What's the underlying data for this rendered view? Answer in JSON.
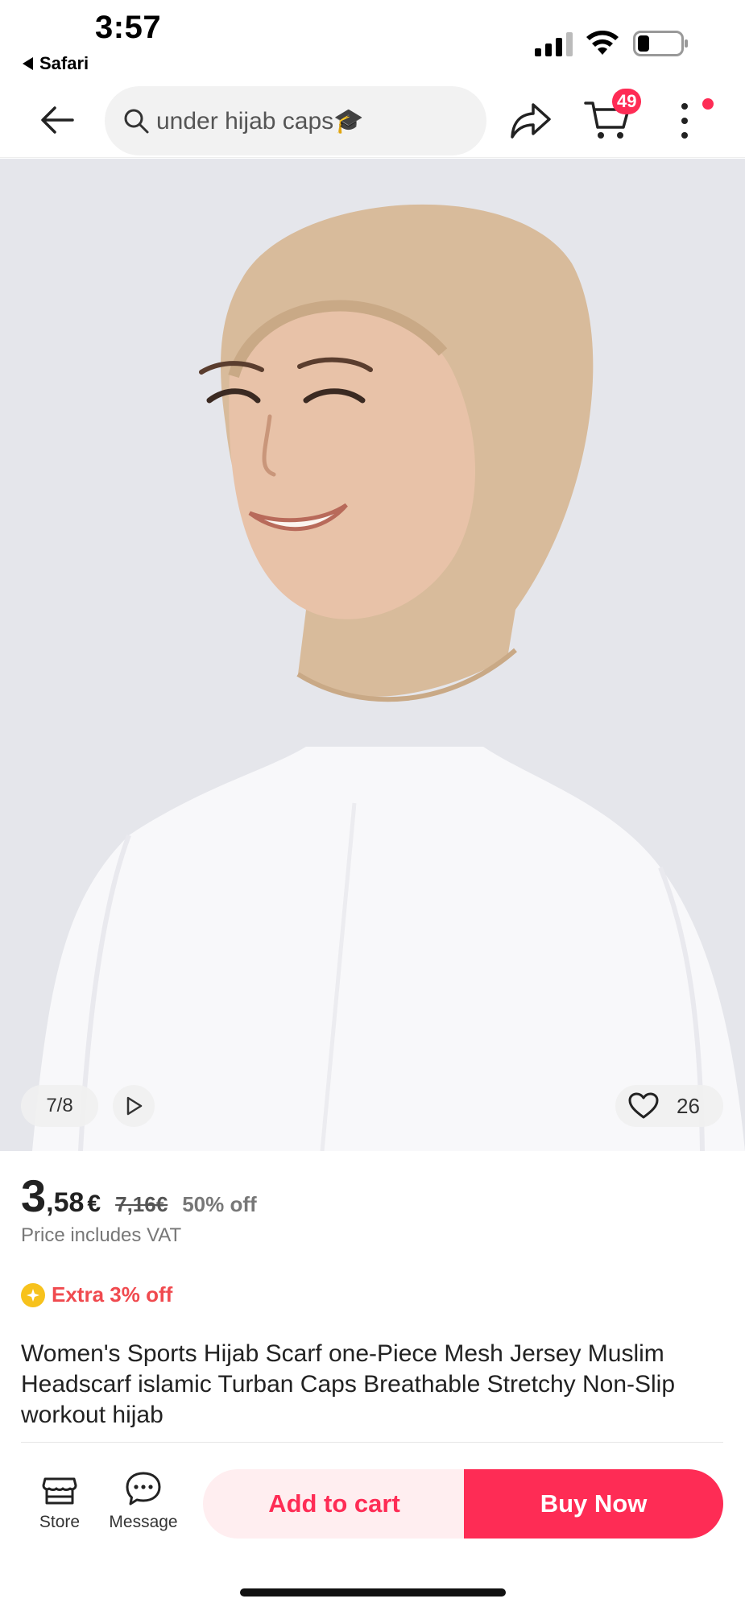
{
  "status_bar": {
    "time": "3:57",
    "back_app": "Safari"
  },
  "search": {
    "query": "under hijab caps🎓"
  },
  "header": {
    "cart_count": "49"
  },
  "gallery": {
    "counter": "7/8",
    "like_count": "26"
  },
  "price": {
    "integer": "3",
    "decimal": ",58",
    "currency": "€",
    "original": "7,16€",
    "discount": "50% off",
    "vat_note": "Price includes VAT"
  },
  "promo": {
    "extra_off": "Extra 3% off"
  },
  "product": {
    "title": "Women's Sports Hijab Scarf one-Piece Mesh Jersey Muslim Headscarf islamic Turban Caps Breathable Stretchy Non-Slip workout hijab"
  },
  "bottom_bar": {
    "store_label": "Store",
    "message_label": "Message",
    "add_to_cart_label": "Add to cart",
    "buy_now_label": "Buy Now"
  },
  "colors": {
    "accent": "#fe2c55",
    "accent_light": "#ffeef0",
    "promo_text": "#f04a4f",
    "promo_icon": "#f7c21c",
    "image_bg": "#e5e6eb",
    "hijab": "#d8bb9b"
  },
  "icons": [
    "signal-icon",
    "wifi-icon",
    "battery-icon",
    "back-arrow-icon",
    "search-icon",
    "share-icon",
    "cart-icon",
    "more-icon",
    "play-icon",
    "heart-icon",
    "star-badge-icon",
    "store-icon",
    "message-icon"
  ]
}
